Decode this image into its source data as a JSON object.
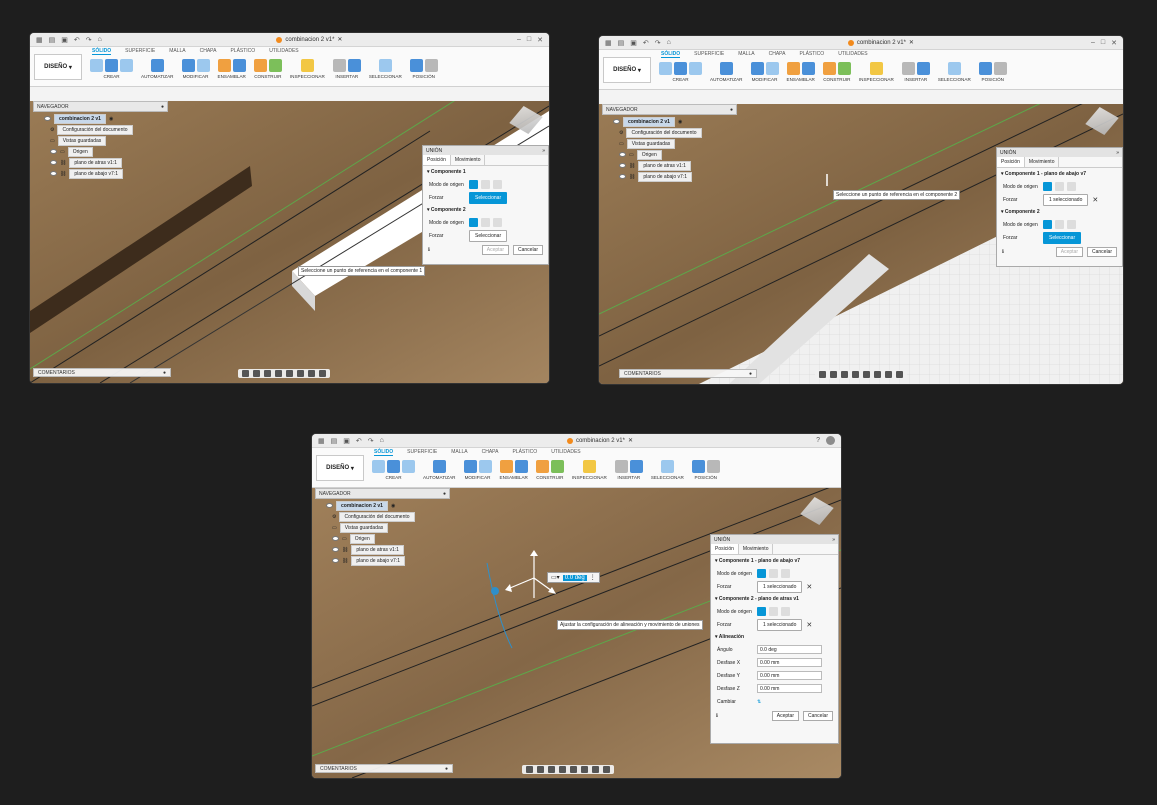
{
  "app": {
    "doc_title": "combinacion 2 v1*",
    "ribbon_tabs": [
      "SÓLIDO",
      "SUPERFICIE",
      "MALLA",
      "CHAPA",
      "PLÁSTICO",
      "UTILIDADES"
    ],
    "workspace_button": "DISEÑO",
    "groups": [
      "CREAR",
      "AUTOMATIZAR",
      "MODIFICAR",
      "ENSAMBLAR",
      "CONSTRUIR",
      "INSPECCIONAR",
      "INSERTAR",
      "SELECCIONAR",
      "POSICIÓN"
    ],
    "navigator_title": "NAVEGADOR",
    "comments_label": "COMENTARIOS",
    "tree": {
      "root": "combinacion 2 v1",
      "items": [
        "Configuración del documento",
        "Vistas guardadas",
        "Origen",
        "plano de atras v1:1",
        "plano de abajo v7:1"
      ]
    },
    "colors": {
      "accent": "#0696d7",
      "wood": "#8b6c49",
      "app_icon": "#f28a1c"
    }
  },
  "window1": {
    "panel": {
      "title": "UNIÓN",
      "tabs": [
        "Posición",
        "Movimiento"
      ],
      "comp1": "Componente 1",
      "comp2": "Componente 2",
      "mode_label": "Modo de origen",
      "snap_label": "Forzar",
      "select_btn": "Seleccionar",
      "ok": "Aceptar",
      "cancel": "Cancelar"
    },
    "tooltip": "Seleccione un punto de referencia en el componente 1"
  },
  "window2": {
    "panel": {
      "title": "UNIÓN",
      "tabs": [
        "Posición",
        "Movimiento"
      ],
      "comp1": "Componente 1 - plano de abajo v7",
      "comp2": "Componente 2",
      "mode_label": "Modo de origen",
      "snap_label": "Forzar",
      "selected": "1 seleccionado",
      "select_btn": "Seleccionar",
      "ok": "Aceptar",
      "cancel": "Cancelar"
    },
    "tooltip": "Seleccione un punto de referencia en el componente 2"
  },
  "window3": {
    "panel": {
      "title": "UNIÓN",
      "tabs": [
        "Posición",
        "Movimiento"
      ],
      "comp1": "Componente 1 - plano de abajo v7",
      "comp2": "Componente 2 - plano de atras v1",
      "mode_label": "Modo de origen",
      "snap_label": "Forzar",
      "selected": "1 seleccionado",
      "align_section": "Alineación",
      "angle_label": "Ángulo",
      "angle_value": "0.0 deg",
      "offx_label": "Desfase X",
      "offx_value": "0.00 mm",
      "offy_label": "Desfase Y",
      "offy_value": "0.00 mm",
      "offz_label": "Desfase Z",
      "offz_value": "0.00 mm",
      "flip_label": "Cambiar",
      "ok": "Aceptar",
      "cancel": "Cancelar"
    },
    "angle_input": "0.0 deg",
    "tooltip": "Ajustar la configuración de alineación y movimiento de uniones"
  }
}
